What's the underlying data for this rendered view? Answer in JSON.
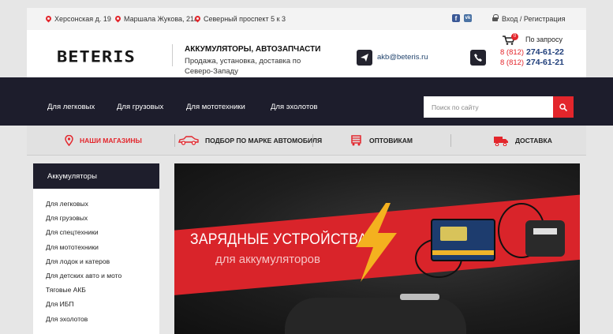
{
  "topbar": {
    "addresses": [
      "Херсонская д. 19",
      "Маршала Жукова, 21а",
      "Северный проспект 5 к 3"
    ],
    "social": [
      {
        "icon": "facebook-icon",
        "glyph": "f"
      },
      {
        "icon": "vk-icon",
        "glyph": "vk"
      }
    ],
    "login_label": "Вход / Регистрация"
  },
  "header": {
    "logo_text": "BETERIS",
    "tagline_title": "АККУМУЛЯТОРЫ, АВТОЗАПЧАСТИ",
    "tagline_sub": "Продажа, установка, доставка по Северо-Западу",
    "email": "akb@beteris.ru",
    "cart_count": "0",
    "cart_label": "По запросу",
    "phones": [
      {
        "prefix": "8 (812)",
        "number": "274-61-22"
      },
      {
        "prefix": "8 (812)",
        "number": "274-61-21"
      }
    ]
  },
  "nav": {
    "items": [
      "Для легковых",
      "Для грузовых",
      "Для мототехники",
      "Для эхолотов"
    ],
    "search_placeholder": "Поиск по сайту"
  },
  "quickbar": {
    "items": [
      {
        "label": "НАШИ МАГАЗИНЫ",
        "icon": "map-pin-icon"
      },
      {
        "label": "ПОДБОР ПО МАРКЕ АВТОМОБИЛЯ",
        "icon": "car-icon"
      },
      {
        "label": "ОПТОВИКАМ",
        "icon": "cart-icon"
      },
      {
        "label": "ДОСТАВКА",
        "icon": "truck-icon"
      }
    ]
  },
  "sidebar": {
    "title": "Аккумуляторы",
    "items": [
      "Для легковых",
      "Для грузовых",
      "Для спецтехники",
      "Для мототехники",
      "Для лодок и катеров",
      "Для детских авто и мото",
      "Тяговые АКБ",
      "Для ИБП",
      "Для эхолотов"
    ]
  },
  "banner": {
    "title": "ЗАРЯДНЫЕ УСТРОЙСТВА",
    "subtitle": "для аккумуляторов"
  },
  "colors": {
    "accent": "#e3262c",
    "dark": "#1d1d2c",
    "link": "#1f3e7a"
  }
}
